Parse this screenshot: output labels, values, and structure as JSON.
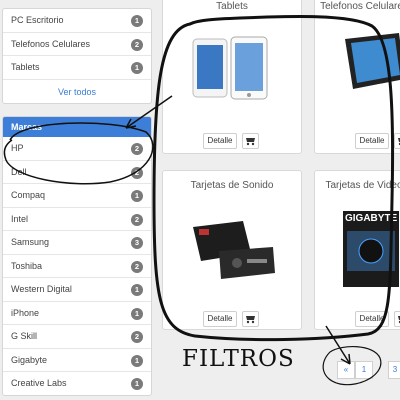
{
  "categories": {
    "items": [
      {
        "label": "PC Escritorio",
        "count": "1"
      },
      {
        "label": "Telefonos Celulares",
        "count": "2"
      },
      {
        "label": "Tablets",
        "count": "1"
      }
    ],
    "see_all": "Ver todos"
  },
  "brands": {
    "title": "Marcas",
    "items": [
      {
        "label": "HP",
        "count": "2"
      },
      {
        "label": "Dell",
        "count": "2"
      },
      {
        "label": "Compaq",
        "count": "1"
      },
      {
        "label": "Intel",
        "count": "2"
      },
      {
        "label": "Samsung",
        "count": "3"
      },
      {
        "label": "Toshiba",
        "count": "2"
      },
      {
        "label": "Western Digital",
        "count": "1"
      },
      {
        "label": "iPhone",
        "count": "1"
      },
      {
        "label": "G Skill",
        "count": "2"
      },
      {
        "label": "Gigabyte",
        "count": "1"
      },
      {
        "label": "Creative Labs",
        "count": "1"
      }
    ]
  },
  "products": {
    "card1": {
      "title": "Tablets",
      "detail_label": "Detalle"
    },
    "card2": {
      "title": "Telefonos Celulares",
      "detail_label": "Detalle"
    },
    "card3": {
      "title": "Tarjetas de Sonido",
      "detail_label": "Detalle"
    },
    "card4": {
      "title": "Tarjetas de Video",
      "detail_label": "Detalle",
      "brand_text": "GIGABYTE"
    }
  },
  "pagination": {
    "prev": "«",
    "current": "1",
    "next_partial": "3"
  },
  "annotation": {
    "text": "FILTROS",
    "ink_color": "#111111"
  },
  "colors": {
    "accent": "#3d7fd8",
    "badge": "#7a7a7a"
  },
  "icons": {
    "cart": "cart-icon"
  }
}
